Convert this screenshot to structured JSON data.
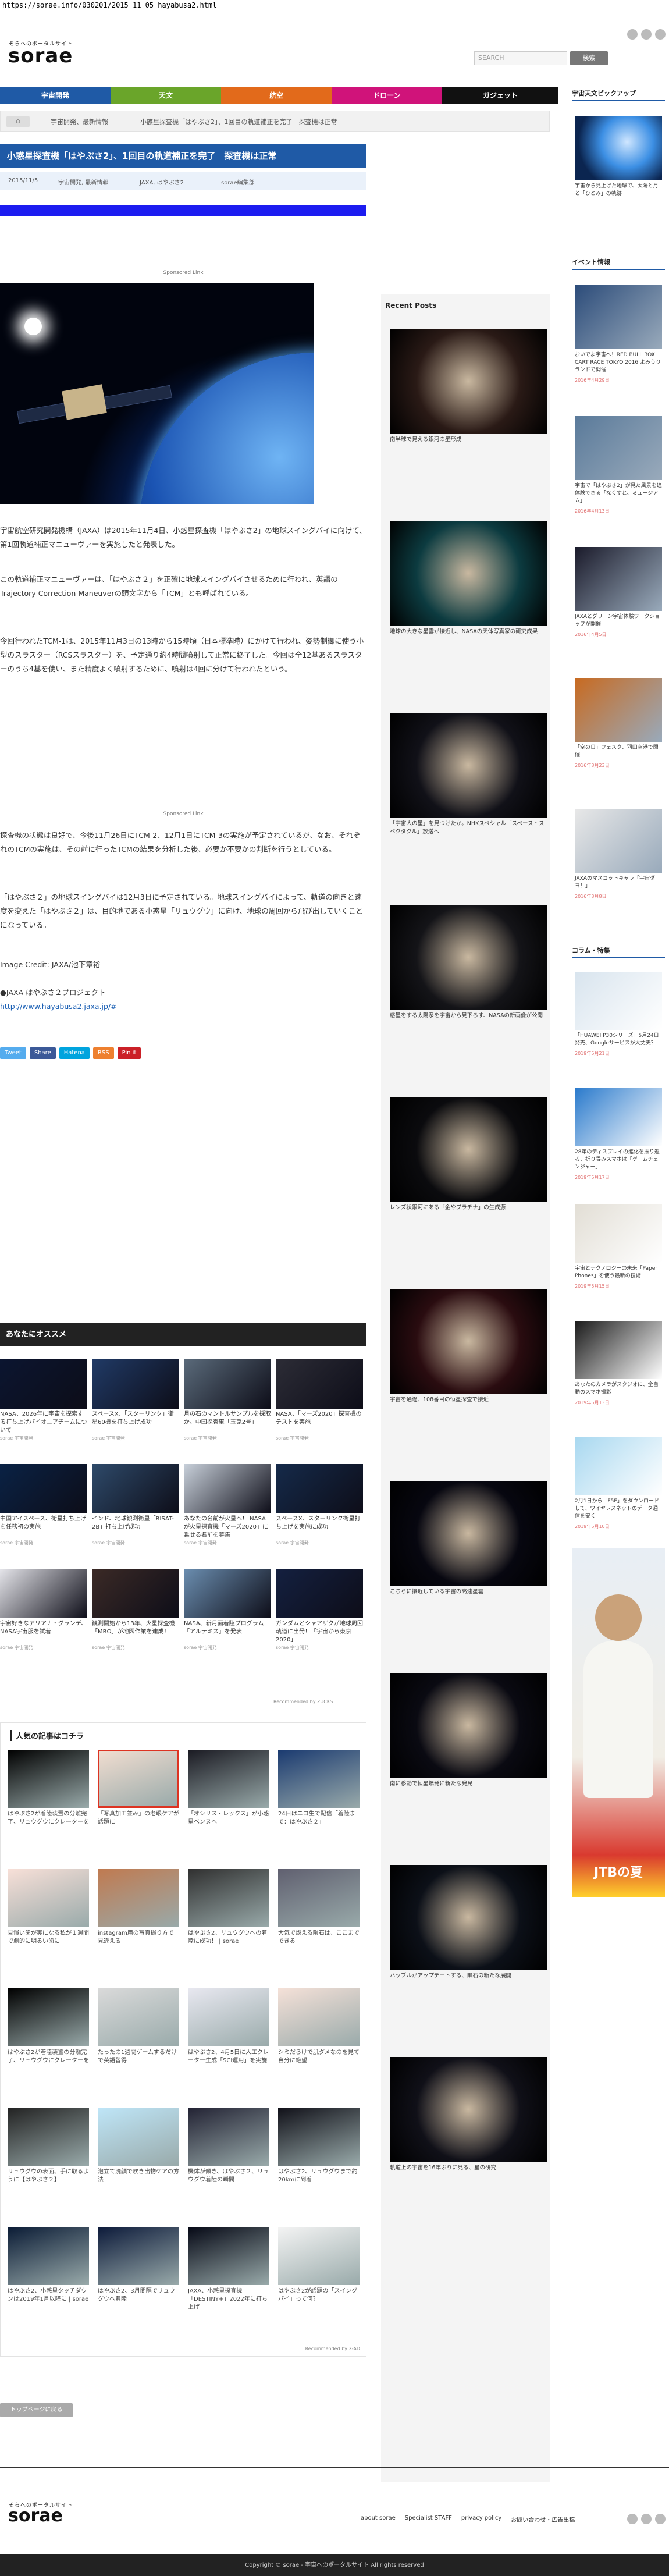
{
  "browser": {
    "url": "https://sorae.info/030201/2015_11_05_hayabusa2.html"
  },
  "header": {
    "tagline": "そらへのポータルサイト",
    "logo": "sorae",
    "search_placeholder": "SEARCH",
    "search_button": "検索"
  },
  "nav": [
    {
      "label": "宇宙開発",
      "color": "#1f5aa6"
    },
    {
      "label": "天文",
      "color": "#6aa52a"
    },
    {
      "label": "航空",
      "color": "#e26a1b"
    },
    {
      "label": "ドローン",
      "color": "#d0137a"
    },
    {
      "label": "ガジェット",
      "color": "#111111"
    }
  ],
  "breadcrumb": {
    "home": "⌂",
    "c1": "宇宙開発、最新情報",
    "c2": "小惑星探査機「はやぶさ2」、1回目の軌道補正を完了　探査機は正常"
  },
  "article": {
    "title": "小惑星探査機「はやぶさ2」、1回目の軌道補正を完了　探査機は正常",
    "date": "2015/11/5",
    "cat1": "宇宙開発, 最新情報",
    "tags": "JAXA, はやぶさ2",
    "editor": "sorae編集部",
    "sponsored": "Sponsored Link",
    "p1": "宇宙航空研究開発機構（JAXA）は2015年11月4日、小惑星探査機「はやぶさ2」の地球スイングバイに向けて、第1回軌道補正マニューヴァーを実施したと発表した。",
    "p2": "この軌道補正マニューヴァーは、「はやぶさ２」を正確に地球スイングバイさせるために行われ、英語のTrajectory Correction Maneuverの頭文字から「TCM」とも呼ばれている。",
    "p3": "今回行われたTCM-1は、2015年11月3日の13時から15時頃（日本標準時）にかけて行われ、姿勢制御に使う小型のスラスター（RCSスラスター）を、予定通り約4時間噴射して正常に終了した。今回は全12基あるスラスターのうち4基を使い、また精度よく噴射するために、噴射は4回に分けて行われたという。",
    "p4": "探査機の状態は良好で、今後11月26日にTCM-2、12月1日にTCM-3の実施が予定されているが、なお、それぞれのTCMの実施は、その前に行ったTCMの結果を分析した後、必要か不要かの判断を行うとしている。",
    "p5": "「はやぶさ２」の地球スイングバイは12月3日に予定されている。地球スイングバイによって、軌道の向きと速度を変えた「はやぶさ２」は、目的地である小惑星「リュウグウ」に向け、地球の周回から飛び出していくことになっている。",
    "credit": "Image Credit: JAXA/池下章裕",
    "link_label": "●JAXA はやぶさ２プロジェクト",
    "link_url": "http://www.hayabusa2.jaxa.jp/#",
    "share": [
      "Tweet",
      "Share",
      "Hatena",
      "RSS",
      "Pin it"
    ]
  },
  "recommend": {
    "heading": "あなたにオススメ",
    "source": "sorae 宇宙開発",
    "items": [
      "NASA、2026年に宇宙を探索する打ち上げパイオニアチームについて",
      "スペースX、「スターリンク」衛星60機を打ち上げ成功",
      "月の石のマントルサンプルを採取か。中国探査車「玉兎2号」",
      "NASA、「マーズ2020」探査機のテストを実施",
      "中国アイスペース、衛星打ち上げを任務初の実施",
      "インド、地球観測衛星「RISAT-2B」打ち上げ成功",
      "あなたの名前が火星へ！ NASAが火星探査機「マーズ2020」に乗せる名前を募集",
      "スペースX、スターリンク衛星打ち上げを実施に成功",
      "宇宙好きなアリアナ・グランデ、NASA宇宙服を試着",
      "観測開始から13年、火星探査機「MRO」が地図作業を達成！",
      "NASA、新月面着陸プログラム「アルテミス」を発表",
      "ガンダムとシャアザクが地球周回軌道に出発！「宇宙から東京2020」"
    ],
    "credit": "Recommended by ZUCKS"
  },
  "popular": {
    "heading": "人気の記事はコチラ",
    "items": [
      "はやぶさ2が着陸装置の分離完了、リュウグウにクレーターを",
      "「写真加工並み」の老眼ケアが話題に",
      "「オシリス・レックス」が小惑星ベンヌへ",
      "24日はニコ生で配信「着陸まで：はやぶさ２」",
      "見慣い歯が実になる私が１週間で劇的に明るい歯に",
      "instagram用の写真撮り方で見違える",
      "はやぶさ2、リュウグウへの着陸に成功！ | sorae",
      "大気で燃える隕石は、ここまでできる",
      "はやぶさ2が着陸装置の分離完了、リュウグウにクレーターを",
      "たったの1週間ゲームするだけで英語習得",
      "はやぶさ2、4月5日に人工クレーター生成「SCI運用」を実施",
      "シミだらけで肌ダメなのを見て自分に絶望",
      "リュウグウの表面、手に取るように【はやぶさ２】",
      "泡立て洗顔で吹き出物ケアの方法",
      "機体が傾き、はやぶさ２、リュウグウ着陸の瞬間",
      "はやぶさ2、リュウグウまで約20kmに到着",
      "はやぶさ2、小惑星タッチダウンは2019年1月以降に | sorae",
      "はやぶさ2、3月間隔でリュウグウへ着陸",
      "JAXA、小惑星探査機「DESTINY+」2022年に打ち上げ",
      "はやぶさ2が話題の「スイングバイ」って何？"
    ],
    "credit": "Recommended by X-AD"
  },
  "back_to_top": "トップページに戻る",
  "recent": {
    "heading": "Recent Posts",
    "items": [
      "南半球で見える銀河の星形成",
      "地球の大きな星雲が接近し、NASAの天体写真家の研究成果",
      "「宇宙人の星」を見つけたか。NHKスペシャル「スペース・スペクタクル」放送へ",
      "惑星をする太陽系を宇宙から見下ろす、NASAの新画像が公開",
      "レンズ状銀河にある「金やプラチナ」の生成源",
      "宇宙を通過、108番目の恒星探査で接近",
      "こちらに接近している宇宙の高速星雲",
      "南に移動で恒星爆発に新たな発見",
      "ハッブルがアップデートする、隕石の新たな展開",
      "軌道上の宇宙を16年ぶりに見る、星の研究"
    ]
  },
  "right": {
    "pickup_heading": "宇宙天文ピックアップ",
    "pickup_text": "宇宙から見上げた地球で、太陽と月と「ひとみ」の軌跡",
    "event_heading": "イベント情報",
    "events": [
      {
        "t": "おいでよ宇宙へ！RED BULL BOX CART RACE TOKYO 2016 よみうりランドで開催",
        "d": "2016年4月29日"
      },
      {
        "t": "宇宙で「はやぶさ2」が見た風景を追体験できる「なくすと、ミュージアム」",
        "d": "2016年4月13日"
      },
      {
        "t": "JAXAとグリーン宇宙体験ワークショップが開催",
        "d": "2016年4月5日"
      },
      {
        "t": "「空の日」フェスタ、羽田空港で開催",
        "d": "2016年3月23日"
      },
      {
        "t": "JAXAのマスコットキャラ「宇宙ダヨ！」",
        "d": "2016年3月8日"
      }
    ],
    "column_heading": "コラム・特集",
    "columns": [
      {
        "t": "「HUAWEI P30シリーズ」5月24日発売、Googleサービスが大丈夫？",
        "d": "2019年5月21日"
      },
      {
        "t": "28年のディスプレイの進化を振り返る、折り畳みスマホは「ゲームチェンジャー」",
        "d": "2019年5月17日"
      },
      {
        "t": "宇宙とテクノロジーの未来「Paper Phones」を使う最新の技術",
        "d": "2019年5月15日"
      },
      {
        "t": "あなたのカメラがスタジオに、全自動のスマホ撮影",
        "d": "2019年5月13日"
      },
      {
        "t": "2月1日から「F5E」をダウンロードして、ワイヤレスネットのデータ通信を安く",
        "d": "2019年5月10日"
      }
    ],
    "ad_text": "JTBの夏"
  },
  "footer": {
    "tagline": "そらへのポータルサイト",
    "logo": "sorae",
    "links": [
      "about sorae",
      "Specialist STAFF",
      "privacy policy",
      "お問い合わせ・広告出稿"
    ],
    "copyright": "Copyright © sorae - 宇宙へのポータルサイト All rights reserved"
  }
}
